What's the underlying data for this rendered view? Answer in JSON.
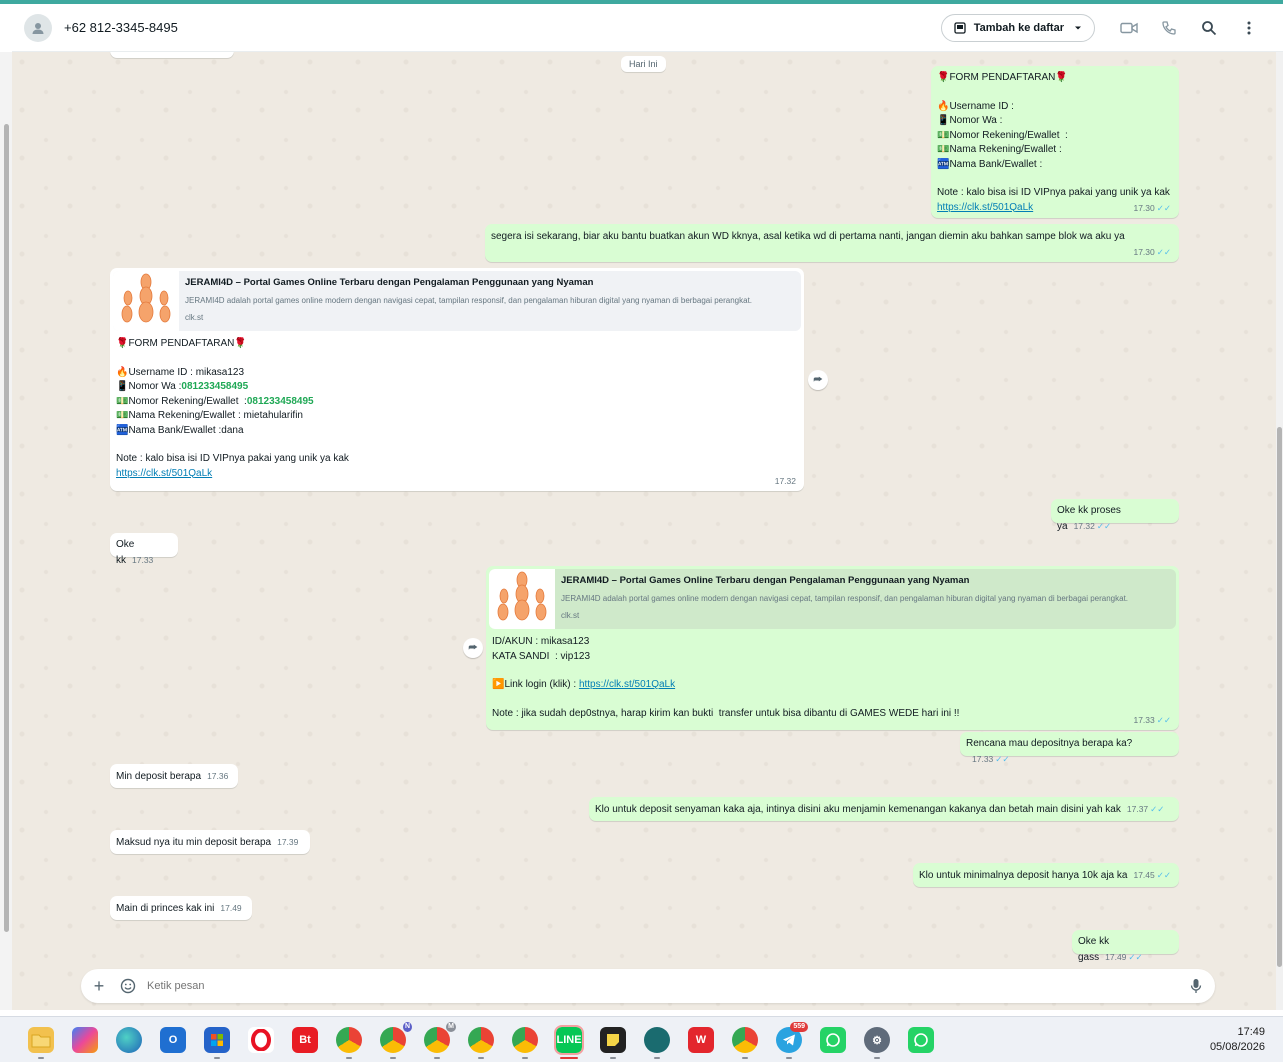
{
  "header": {
    "contact_name": "+62 812-3345-8495",
    "add_to_list_label": "Tambah ke daftar",
    "icons": [
      "video-icon",
      "phone-icon",
      "search-icon",
      "menu-dots-icon"
    ]
  },
  "chat": {
    "date_divider": "Hari Ini",
    "messages": {
      "m1": {
        "direction": "out",
        "emoji_rose": "🌹",
        "form_title": "FORM PENDAFTARAN",
        "line_username": "Username ID :",
        "line_nomor_wa": "Nomor Wa :",
        "line_rekening": "Nomor Rekening/Ewallet  :",
        "line_nama_rekening": "Nama Rekening/Ewallet :",
        "line_bank": "Nama Bank/Ewallet :",
        "note": "Note : kalo bisa isi ID VIPnya pakai yang unik ya kak",
        "link": "https://clk.st/501QaLk",
        "time": "17.30"
      },
      "m2": {
        "direction": "out",
        "text": "segera isi sekarang, biar aku bantu buatkan akun WD kknya, asal ketika wd di pertama nanti, jangan diemin aku bahkan sampe blok wa aku ya",
        "time": "17.30"
      },
      "m3": {
        "direction": "in",
        "preview_title": "JERAMI4D – Portal Games Online Terbaru dengan Pengalaman Penggunaan yang Nyaman",
        "preview_desc": "JERAMI4D adalah portal games online modern dengan navigasi cepat, tampilan responsif, dan pengalaman hiburan digital yang nyaman di berbagai perangkat.",
        "preview_host": "clk.st",
        "form_title": "FORM PENDAFTARAN",
        "line_username": "Username ID : mikasa123",
        "label_nomor_wa": "Nomor Wa :",
        "value_nomor_wa": "081233458495",
        "label_rekening": "Nomor Rekening/Ewallet  :",
        "value_rekening": "081233458495",
        "line_nama_rekening": "Nama Rekening/Ewallet : mietahularifin",
        "line_bank": "Nama Bank/Ewallet :dana",
        "note": "Note : kalo bisa isi ID VIPnya pakai yang unik ya kak",
        "link": "https://clk.st/501QaLk",
        "time": "17.32"
      },
      "m4": {
        "direction": "out",
        "text": "Oke kk proses ya",
        "time": "17.32"
      },
      "m5": {
        "direction": "in",
        "text": "Oke kk",
        "time": "17.33"
      },
      "m6": {
        "direction": "out",
        "preview_title": "JERAMI4D – Portal Games Online Terbaru dengan Pengalaman Penggunaan yang Nyaman",
        "preview_desc": "JERAMI4D adalah portal games online modern dengan navigasi cepat, tampilan responsif, dan pengalaman hiburan digital yang nyaman di berbagai perangkat.",
        "preview_host": "clk.st",
        "line_id": "ID/AKUN : mikasa123",
        "line_pass": "KATA SANDI  : vip123",
        "login_label": "Link login (klik) :",
        "link": "https://clk.st/501QaLk",
        "note": "Note : jika sudah dep0stnya, harap kirim kan bukti  transfer untuk bisa dibantu di GAMES WEDE hari ini !!",
        "time": "17.33"
      },
      "m7": {
        "direction": "out",
        "text": "Rencana mau depositnya berapa ka?",
        "time": "17.33"
      },
      "m8": {
        "direction": "in",
        "text": "Min deposit berapa",
        "time": "17.36"
      },
      "m9": {
        "direction": "out",
        "text": "Klo untuk deposit senyaman kaka aja, intinya disini aku menjamin kemenangan kakanya dan betah main disini yah kak",
        "time": "17.37"
      },
      "m10": {
        "direction": "in",
        "text": "Maksud nya itu min deposit berapa",
        "time": "17.39"
      },
      "m11": {
        "direction": "out",
        "text": "Klo untuk minimalnya deposit hanya 10k aja ka",
        "time": "17.45"
      },
      "m12": {
        "direction": "in",
        "text": "Main di princes kak ini",
        "time": "17.49"
      },
      "m13": {
        "direction": "out",
        "text": "Oke kk gass",
        "time": "17.49"
      }
    }
  },
  "composer": {
    "placeholder": "Ketik pesan"
  },
  "taskbar": {
    "clock_time": "17:49",
    "clock_date": "05/08/2026",
    "bt_label": "Bt",
    "telegram_badge": "559",
    "chrome_n_label": "N",
    "chrome_m_label": "M"
  },
  "colors": {
    "outgoing_bubble": "#d9fdd3",
    "incoming_bubble": "#ffffff",
    "chat_background": "#efeae2",
    "link": "#027eb5",
    "read_ticks": "#53bdeb"
  }
}
